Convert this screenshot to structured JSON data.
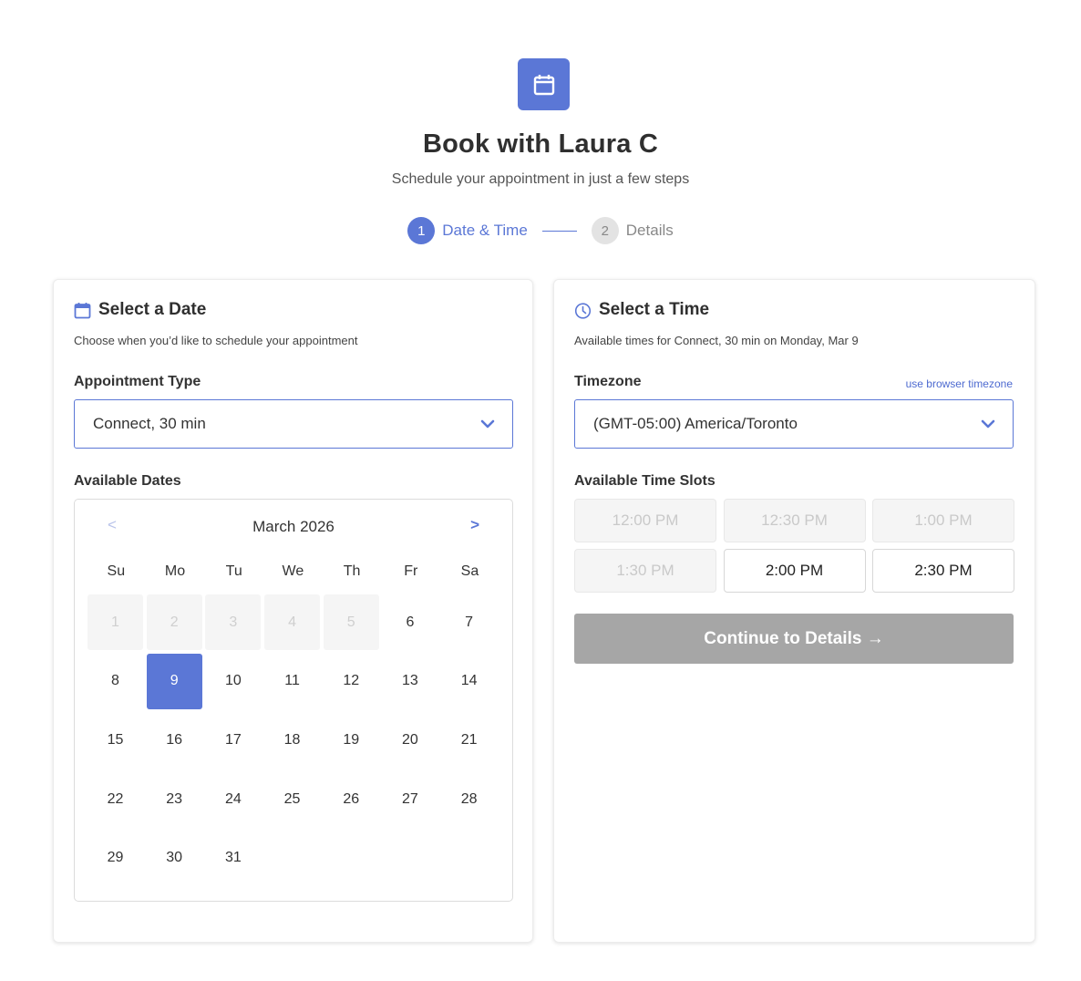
{
  "header": {
    "logo_icon": "calendar-icon",
    "title": "Book with Laura C",
    "subtitle": "Schedule your appointment in just a few steps"
  },
  "steps": [
    {
      "number": "1",
      "label": "Date & Time",
      "state": "active"
    },
    {
      "number": "2",
      "label": "Details",
      "state": "inactive"
    }
  ],
  "date_panel": {
    "icon": "calendar-icon",
    "title": "Select a Date",
    "description": "Choose when you’d like to schedule your appointment",
    "appointment_type_label": "Appointment Type",
    "appointment_type_value": "Connect, 30 min",
    "available_dates_label": "Available Dates",
    "calendar": {
      "prev": "<",
      "next": ">",
      "month": "March 2026",
      "weekdays": [
        "Su",
        "Mo",
        "Tu",
        "We",
        "Th",
        "Fr",
        "Sa"
      ],
      "days": [
        "1",
        "2",
        "3",
        "4",
        "5",
        "6",
        "7",
        "8",
        "9",
        "10",
        "11",
        "12",
        "13",
        "14",
        "15",
        "16",
        "17",
        "18",
        "19",
        "20",
        "21",
        "22",
        "23",
        "24",
        "25",
        "26",
        "27",
        "28",
        "29",
        "30",
        "31"
      ],
      "disabled_days": [
        "1",
        "2",
        "3",
        "4",
        "5"
      ],
      "selected_day": "9"
    }
  },
  "time_panel": {
    "icon": "clock-icon",
    "title": "Select a Time",
    "description": "Available times for Connect, 30 min on Monday, Mar 9",
    "timezone_label": "Timezone",
    "browser_timezone_link": "use browser timezone",
    "timezone_value": "(GMT-05:00) America/Toronto",
    "slots_label": "Available Time Slots",
    "slots": [
      {
        "time": "12:00 PM",
        "available": false
      },
      {
        "time": "12:30 PM",
        "available": false
      },
      {
        "time": "1:00 PM",
        "available": false
      },
      {
        "time": "1:30 PM",
        "available": false
      },
      {
        "time": "2:00 PM",
        "available": true
      },
      {
        "time": "2:30 PM",
        "available": true
      }
    ],
    "continue_label": "Continue to Details →"
  },
  "colors": {
    "accent": "#5b77d6",
    "disabled_button": "#a6a6a6"
  }
}
